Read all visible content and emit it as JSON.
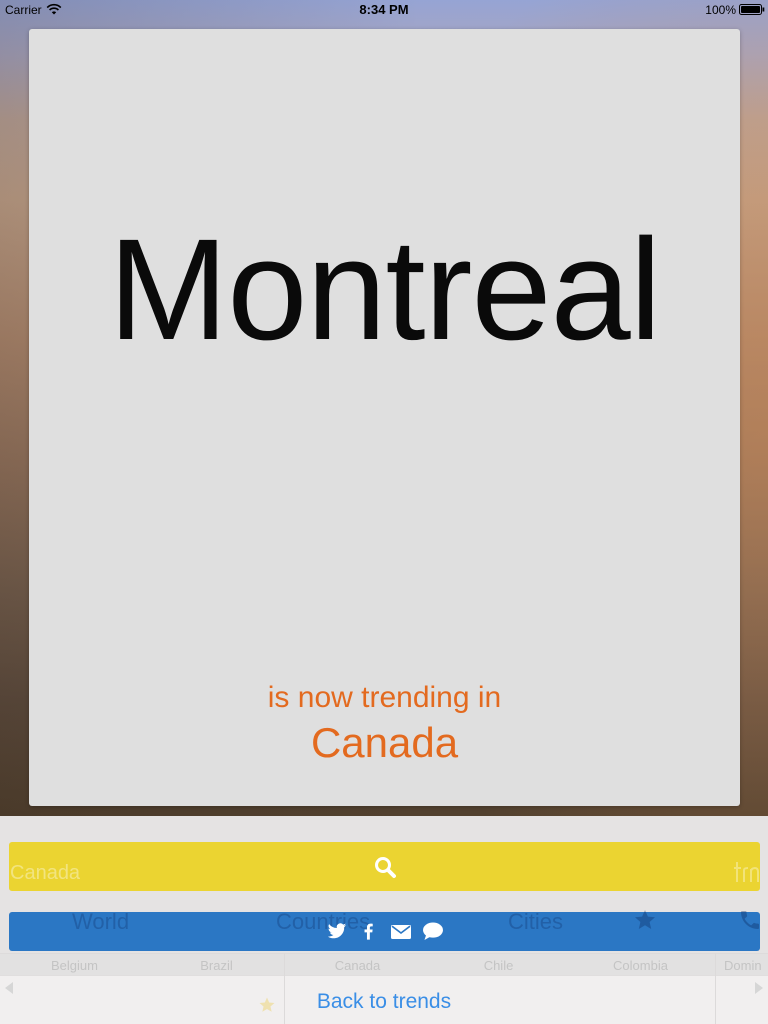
{
  "status_bar": {
    "carrier": "Carrier",
    "time": "8:34 PM",
    "battery": "100%",
    "wifi_icon": "wifi-icon",
    "battery_icon": "battery-icon"
  },
  "trend_card": {
    "title": "Montreal",
    "subtitle": "is now trending in",
    "location": "Canada"
  },
  "search_button": {
    "icon": "search-icon"
  },
  "share_bar": {
    "icons": [
      "twitter-icon",
      "facebook-icon",
      "mail-icon",
      "chat-icon"
    ]
  },
  "back_link": {
    "label": "Back to trends"
  },
  "background_app": {
    "search_value": "Canada",
    "logo_icon": "app-logo-icon",
    "tabs": [
      "World",
      "Countries",
      "Cities"
    ],
    "tab_icons": [
      "star-icon",
      "phone-icon"
    ],
    "countries": [
      "Belgium",
      "Brazil",
      "Canada",
      "Chile",
      "Colombia",
      "Domin"
    ],
    "nav_icons": [
      "arrow-left-icon",
      "arrow-right-icon",
      "star-icon"
    ]
  },
  "colors": {
    "accent": "#e36a1f",
    "search_bar": "#ebd431",
    "share_bar": "#2b77c4",
    "link": "#3a8ee6",
    "card": "#dfdfdf"
  }
}
